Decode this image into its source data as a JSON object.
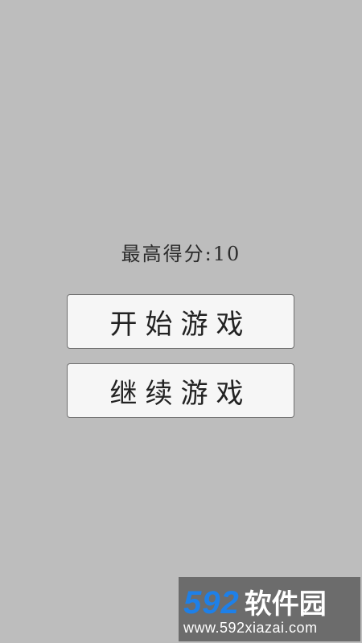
{
  "menu": {
    "high_score_label": "最高得分:",
    "high_score_value": "10",
    "start_button": "开始游戏",
    "continue_button": "继续游戏"
  },
  "watermark": {
    "number": "592",
    "text": "软件园",
    "url": "www.592xiazai.com"
  },
  "colors": {
    "background": "#bdbdbd",
    "button_bg": "#f6f6f6",
    "watermark_bg": "#6c6c6c",
    "watermark_accent": "#1e80e8"
  }
}
